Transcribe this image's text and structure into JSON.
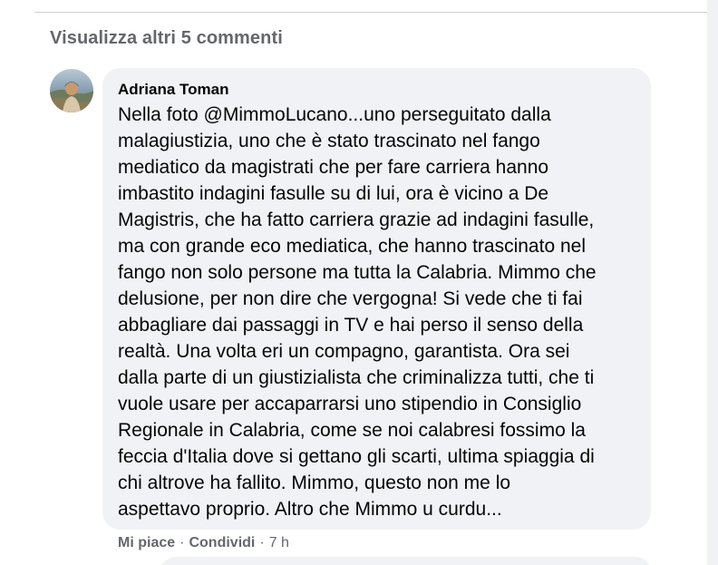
{
  "comments": {
    "more_link": "Visualizza altri 5 commenti",
    "comment": {
      "author": "Adriana Toman",
      "text": "Nella foto @MimmoLucano...uno perseguitato dalla\nmalagiustizia, uno che è stato trascinato nel fango\nmediatico da magistrati che per fare carriera hanno\nimbastito indagini fasulle su di lui, ora è vicino a De\nMagistris, che ha fatto carriera grazie ad indagini fasulle,\nma con grande eco mediatica, che hanno trascinato nel\nfango non solo persone ma tutta la Calabria. Mimmo che\ndelusione, per non dire che vergogna! Si vede che ti fai\nabbagliare dai passaggi in TV e hai perso il senso della\nrealtà. Una volta eri un compagno, garantista. Ora sei\ndalla parte di un giustizialista che criminalizza tutti, che ti\nvuole usare per accaparrarsi uno stipendio in Consiglio\nRegionale in Calabria, come se noi calabresi fossimo la\nfeccia d'Italia dove si gettano gli scarti, ultima spiaggia di\nchi altrove ha fallito. Mimmo, questo non me lo\naspettavo proprio. Altro che Mimmo u curdu...",
      "actions": {
        "like": "Mi piace",
        "separator": "·",
        "share": "Condividi",
        "time": "7 h"
      }
    }
  },
  "colors": {
    "bubble_bg": "#f0f2f5",
    "secondary_text": "#65676b",
    "primary_text": "#050505"
  }
}
